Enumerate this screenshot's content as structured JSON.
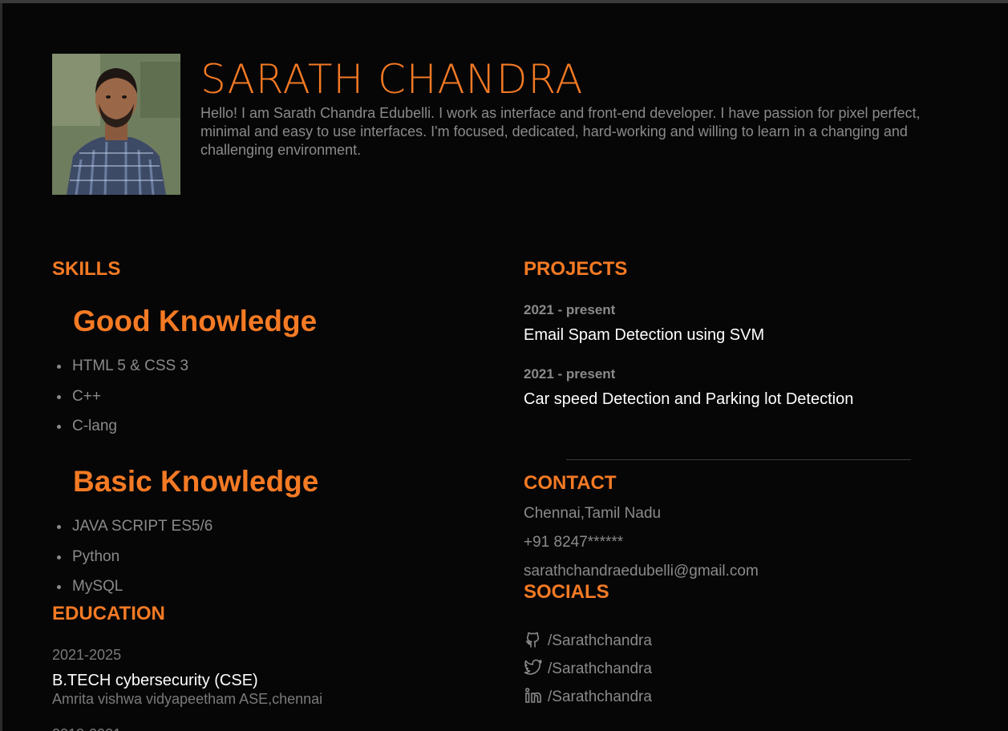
{
  "profile": {
    "name": "SARATH CHANDRA",
    "bio": "Hello! I am Sarath Chandra Edubelli. I work as interface and front-end developer. I have passion for pixel perfect, minimal and easy to use interfaces. I'm focused, dedicated, hard-working and willing to learn in a changing and challenging environment.",
    "photo_icon": "person-photo"
  },
  "skills": {
    "heading": "SKILLS",
    "good": {
      "heading": "Good Knowledge",
      "items": [
        "HTML 5 & CSS 3",
        "C++",
        "C-lang"
      ]
    },
    "basic": {
      "heading": "Basic Knowledge",
      "items": [
        "JAVA SCRIPT ES5/6",
        "Python",
        "MySQL"
      ]
    }
  },
  "education": {
    "heading": "EDUCATION",
    "entries": [
      {
        "years": "2021-2025",
        "degree": "B.TECH cybersecurity (CSE)",
        "school": "Amrita vishwa vidyapeetham ASE,chennai"
      }
    ]
  },
  "projects": {
    "heading": "PROJECTS",
    "items": [
      {
        "date": "2021 - present",
        "title": "Email Spam Detection using SVM"
      },
      {
        "date": "2021 - present",
        "title": "Car speed Detection and Parking lot Detection"
      }
    ]
  },
  "contact": {
    "heading": "CONTACT",
    "location": "Chennai,Tamil Nadu",
    "phone": "+91 8247******",
    "email": "sarathchandraedubelli@gmail.com"
  },
  "socials": {
    "heading": "SOCIALS",
    "items": [
      {
        "icon": "github-icon",
        "handle": "/Sarathchandra"
      },
      {
        "icon": "twitter-icon",
        "handle": "/Sarathchandra"
      },
      {
        "icon": "linkedin-icon",
        "handle": "/Sarathchandra"
      }
    ]
  },
  "colors": {
    "accent": "#f47a24",
    "background": "#060606",
    "muted_text": "#8a8a8a"
  }
}
